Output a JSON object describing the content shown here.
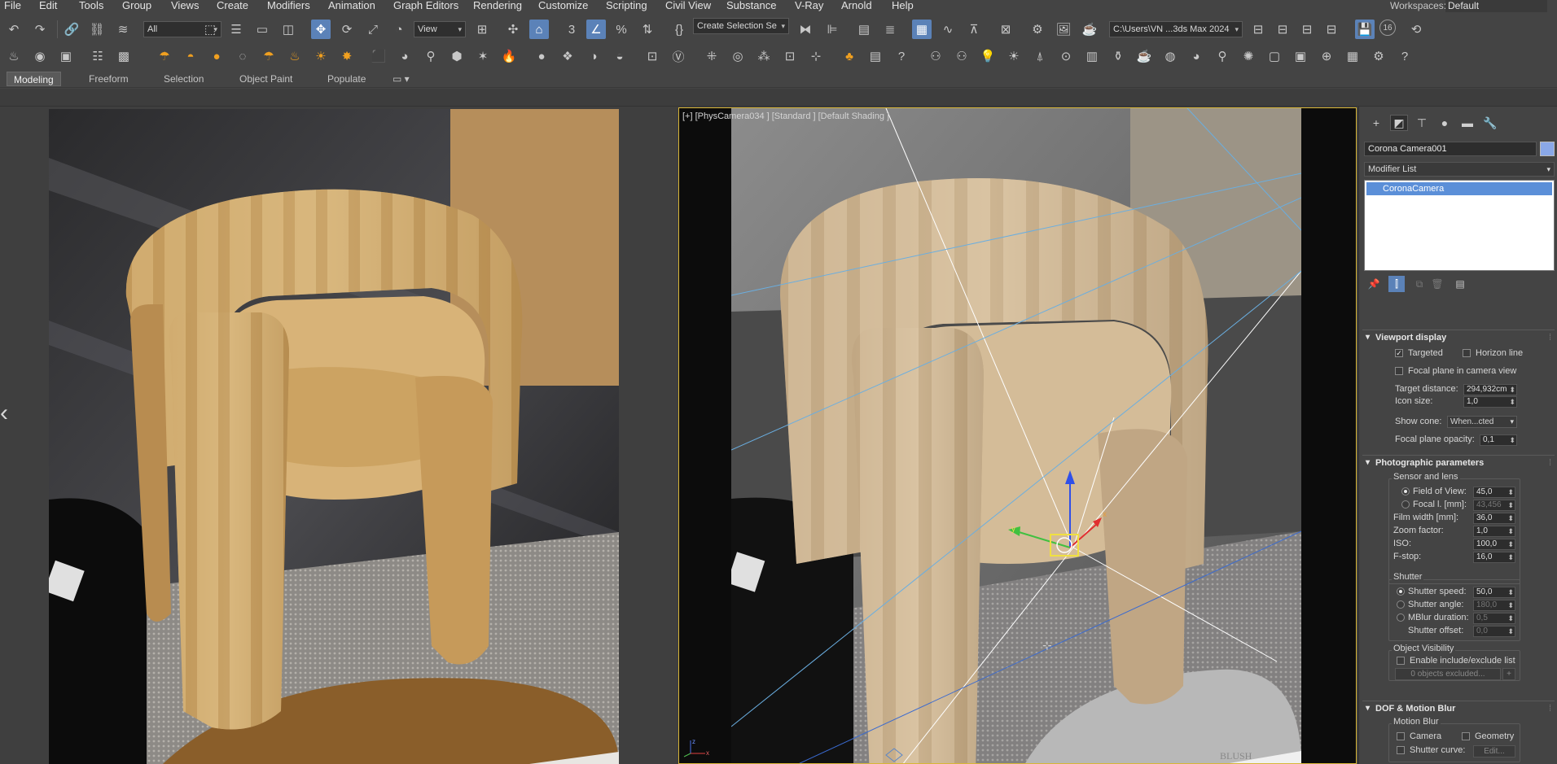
{
  "menu": {
    "items": [
      "File",
      "Edit",
      "Tools",
      "Group",
      "Views",
      "Create",
      "Modifiers",
      "Animation",
      "Graph Editors",
      "Rendering",
      "Customize",
      "Scripting",
      "Civil View",
      "Substance",
      "V-Ray",
      "Arnold",
      "Help"
    ],
    "workspaces_label": "Workspaces:",
    "workspace_value": "Default"
  },
  "toolbar": {
    "selection_filter": "All",
    "ref_coord": "View",
    "named_selection": "Create Selection Se",
    "project_path": "C:\\Users\\VN ...3ds Max 2024",
    "counter": "16"
  },
  "ribbon": {
    "tabs": [
      "Modeling",
      "Freeform",
      "Selection",
      "Object Paint",
      "Populate"
    ],
    "active_tab": "Modeling"
  },
  "viewport": {
    "label": "[+] [PhysCamera034 ] [Standard ] [Default Shading ]",
    "book_text": "BLUSH",
    "axis_x": "x",
    "axis_y": "y",
    "axis_z": "z"
  },
  "command_panel": {
    "object_name": "Corona Camera001",
    "object_color": "#8aa8e8",
    "modifier_list": "Modifier List",
    "stack_item": "CoronaCamera",
    "viewport_display": {
      "title": "Viewport display",
      "targeted": "Targeted",
      "targeted_checked": true,
      "horizon_line": "Horizon line",
      "horizon_checked": false,
      "focal_plane": "Focal plane in camera view",
      "focal_checked": false,
      "target_distance_label": "Target distance:",
      "target_distance": "294,932cm",
      "icon_size_label": "Icon size:",
      "icon_size": "1,0",
      "show_cone_label": "Show cone:",
      "show_cone": "When...cted",
      "focal_opacity_label": "Focal plane opacity:",
      "focal_opacity": "0,1"
    },
    "photographic": {
      "title": "Photographic parameters",
      "sensor_group": "Sensor and lens",
      "fov_label": "Field of View:",
      "fov": "45,0",
      "focal_label": "Focal l. [mm]:",
      "focal": "43,456",
      "film_label": "Film width [mm]:",
      "film": "36,0",
      "zoom_label": "Zoom factor:",
      "zoom": "1,0",
      "iso_label": "ISO:",
      "iso": "100,0",
      "fstop_label": "F-stop:",
      "fstop": "16,0",
      "shutter_group": "Shutter",
      "speed_label": "Shutter speed:",
      "speed": "50,0",
      "angle_label": "Shutter angle:",
      "angle": "180,0",
      "mblur_label": "MBlur duration:",
      "mblur": "0,5",
      "offset_label": "Shutter offset:",
      "offset": "0,0",
      "visibility_group": "Object Visibility",
      "include_label": "Enable include/exclude list",
      "excluded_btn": "0 objects excluded...",
      "plus": "+"
    },
    "dof": {
      "title": "DOF & Motion Blur",
      "motion_group": "Motion Blur",
      "camera": "Camera",
      "geometry": "Geometry",
      "shutter_curve": "Shutter curve:",
      "edit_btn": "Edit..."
    }
  }
}
